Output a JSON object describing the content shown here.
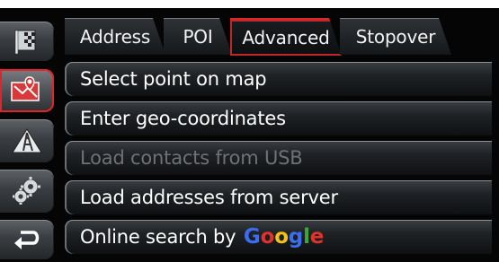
{
  "tabs": [
    {
      "label": "Address",
      "active": false
    },
    {
      "label": "POI",
      "active": false
    },
    {
      "label": "Advanced",
      "active": true
    },
    {
      "label": "Stopover",
      "active": false
    }
  ],
  "menu": {
    "select_point": "Select point on map",
    "enter_coords": "Enter geo-coordinates",
    "load_contacts": "Load contacts from USB",
    "load_addresses": "Load addresses from server",
    "online_search_prefix": "Online search by",
    "google_logo": "Google"
  },
  "sidebar": [
    {
      "icon": "destination-flag-icon",
      "active": false
    },
    {
      "icon": "navigation-map-icon",
      "active": true
    },
    {
      "icon": "route-road-icon",
      "active": false
    },
    {
      "icon": "settings-gears-icon",
      "active": false
    },
    {
      "icon": "back-arrow-icon",
      "active": false
    }
  ],
  "colors": {
    "accent": "#d82a2a",
    "background": "#050505",
    "text": "#ffffff",
    "disabled_text": "#6e7175"
  }
}
